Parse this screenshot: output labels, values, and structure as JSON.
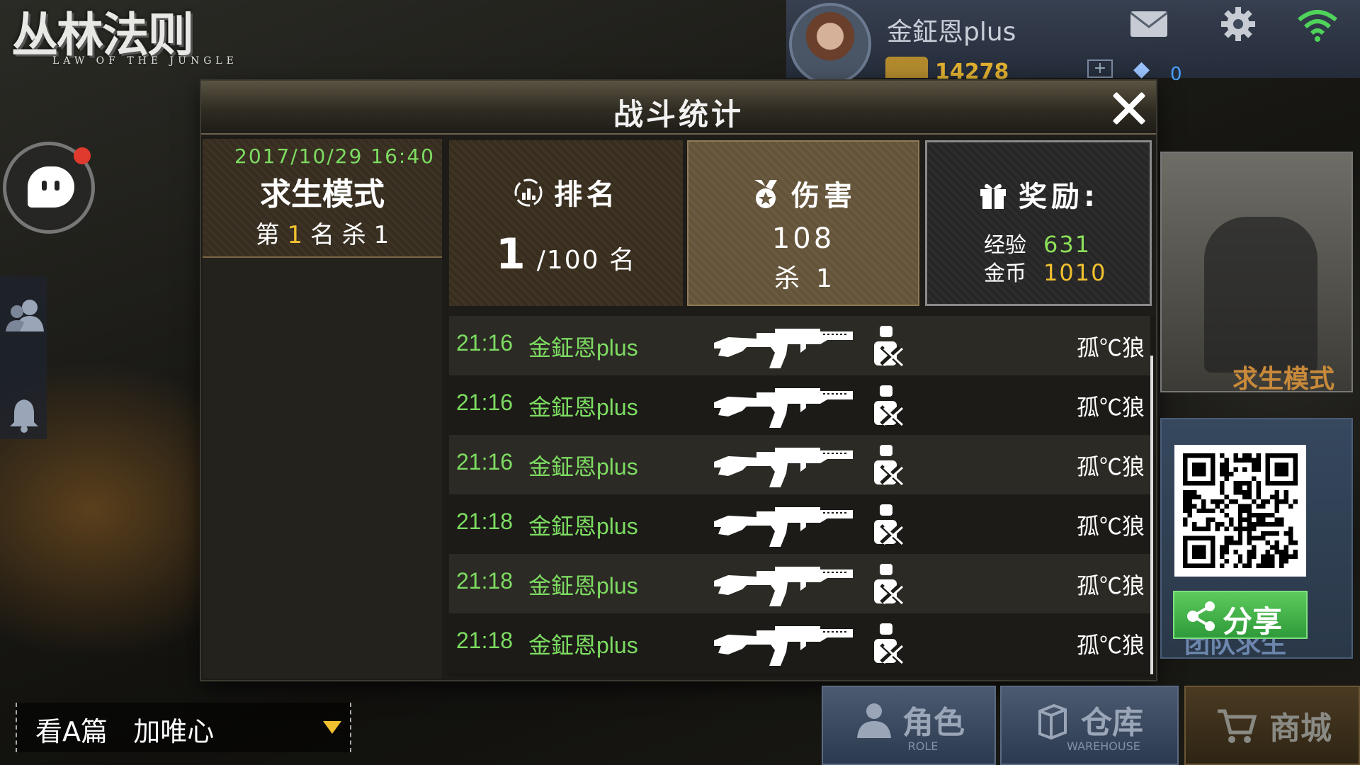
{
  "logo": {
    "title_cn": "丛林法则",
    "title_en": "LAW OF THE JUNGLE"
  },
  "header": {
    "username": "金鉦恩plus",
    "coins": "14278",
    "gems": "0",
    "add": "+"
  },
  "dialog": {
    "title": "战斗统计",
    "match": {
      "datetime": "2017/10/29 16:40",
      "mode": "求生模式",
      "rank_prefix": "第 ",
      "rank": "1",
      "rank_suffix": " 名 杀 1"
    },
    "rank_card": {
      "label": "排名",
      "rank": "1",
      "total": "/100 名"
    },
    "damage_card": {
      "label": "伤害",
      "damage": "108",
      "kills": "杀  1"
    },
    "reward_card": {
      "label": "奖励:",
      "exp_label": "经验",
      "exp_value": "631",
      "gold_label": "金币",
      "gold_value": "1010"
    },
    "kill_log": [
      {
        "time": "21:16",
        "killer": "金鉦恩plus",
        "weapon": "rifle-icon",
        "victim": "孤℃狼"
      },
      {
        "time": "21:16",
        "killer": "金鉦恩plus",
        "weapon": "rifle-icon",
        "victim": "孤℃狼"
      },
      {
        "time": "21:16",
        "killer": "金鉦恩plus",
        "weapon": "rifle-icon",
        "victim": "孤℃狼"
      },
      {
        "time": "21:18",
        "killer": "金鉦恩plus",
        "weapon": "rifle-icon",
        "victim": "孤℃狼"
      },
      {
        "time": "21:18",
        "killer": "金鉦恩plus",
        "weapon": "rifle-icon",
        "victim": "孤℃狼"
      },
      {
        "time": "21:18",
        "killer": "金鉦恩plus",
        "weapon": "rifle-icon",
        "victim": "孤℃狼"
      }
    ]
  },
  "right_panel": {
    "mode_label": "求生模式",
    "team_label": "团队求生",
    "share_label": "分享"
  },
  "chat": {
    "text": "看A篇   加唯心"
  },
  "nav": {
    "role": {
      "label": "角色",
      "sub": "ROLE"
    },
    "warehouse": {
      "label": "仓库",
      "sub": "WAREHOUSE"
    },
    "shop": {
      "label": "商城"
    }
  },
  "colors": {
    "accent_green": "#7ddc62",
    "gold": "#f0c030",
    "share_green": "#3faa46"
  }
}
